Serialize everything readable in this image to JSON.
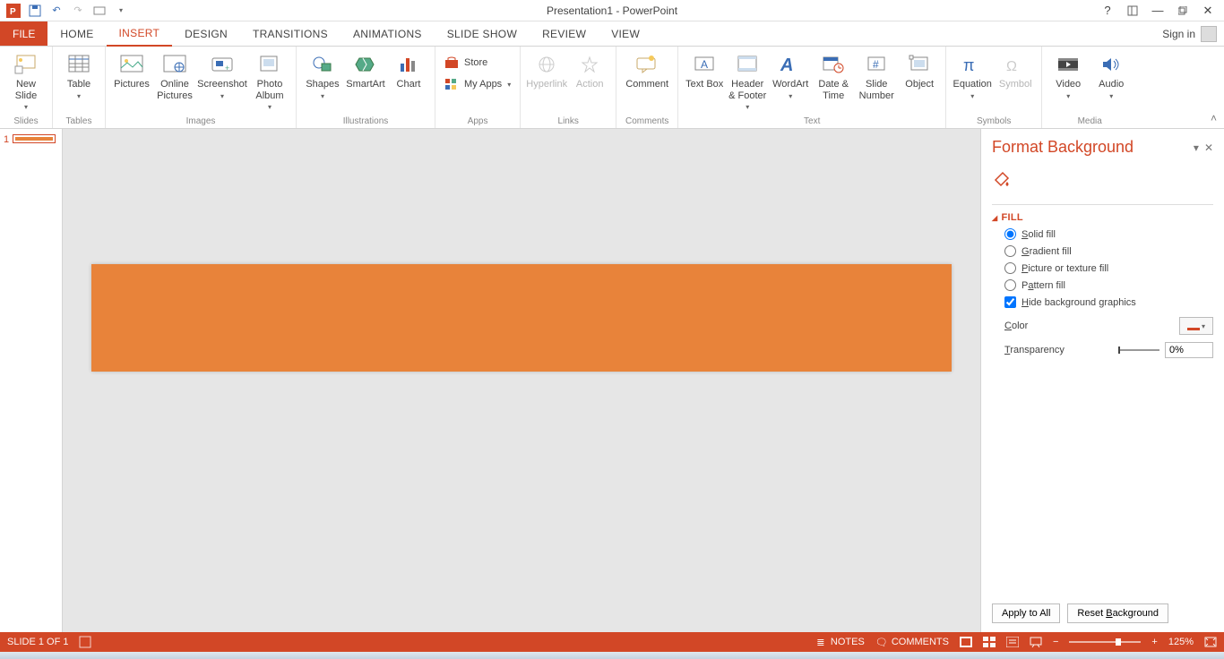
{
  "title": "Presentation1 - PowerPoint",
  "signin": "Sign in",
  "tabs": {
    "file": "FILE",
    "home": "HOME",
    "insert": "INSERT",
    "design": "DESIGN",
    "transitions": "TRANSITIONS",
    "animations": "ANIMATIONS",
    "slideshow": "SLIDE SHOW",
    "review": "REVIEW",
    "view": "VIEW"
  },
  "ribbon": {
    "slides": {
      "new_slide": "New Slide",
      "label": "Slides"
    },
    "tables": {
      "table": "Table",
      "label": "Tables"
    },
    "images": {
      "pictures": "Pictures",
      "online_pictures": "Online Pictures",
      "screenshot": "Screenshot",
      "photo_album": "Photo Album",
      "label": "Images"
    },
    "illustrations": {
      "shapes": "Shapes",
      "smartart": "SmartArt",
      "chart": "Chart",
      "label": "Illustrations"
    },
    "apps": {
      "store": "Store",
      "my_apps": "My Apps",
      "label": "Apps"
    },
    "links": {
      "hyperlink": "Hyperlink",
      "action": "Action",
      "label": "Links"
    },
    "comments": {
      "comment": "Comment",
      "label": "Comments"
    },
    "text": {
      "text_box": "Text Box",
      "header_footer": "Header & Footer",
      "wordart": "WordArt",
      "date_time": "Date & Time",
      "slide_number": "Slide Number",
      "object": "Object",
      "label": "Text"
    },
    "symbols": {
      "equation": "Equation",
      "symbol": "Symbol",
      "label": "Symbols"
    },
    "media": {
      "video": "Video",
      "audio": "Audio",
      "label": "Media"
    }
  },
  "thumbs": {
    "n1": "1"
  },
  "pane": {
    "title": "Format Background",
    "fill_section": "FILL",
    "solid": "Solid fill",
    "gradient": "Gradient fill",
    "picture": "Picture or texture fill",
    "pattern": "Pattern fill",
    "hide": "Hide background graphics",
    "color": "Color",
    "transparency": "Transparency",
    "transparency_val": "0%",
    "apply_all": "Apply to All",
    "reset": "Reset Background"
  },
  "status": {
    "slide": "SLIDE 1 OF 1",
    "notes": "NOTES",
    "comments": "COMMENTS",
    "zoom": "125%"
  }
}
